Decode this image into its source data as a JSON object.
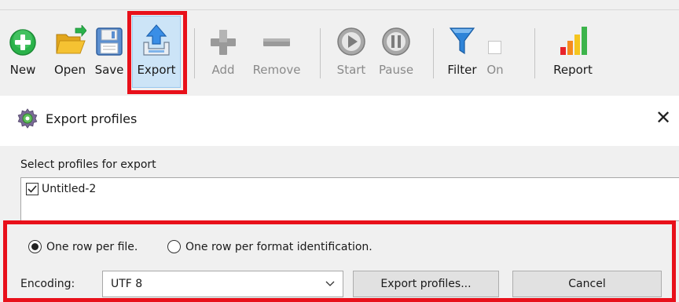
{
  "toolbar": {
    "buttons": {
      "new": "New",
      "open": "Open",
      "save": "Save",
      "export": "Export",
      "add": "Add",
      "remove": "Remove",
      "start": "Start",
      "pause": "Pause",
      "filter": "Filter",
      "on": "On",
      "report": "Report"
    },
    "icons": {
      "new": "plus-circle-icon",
      "open": "folder-open-icon",
      "save": "floppy-disk-icon",
      "export": "export-tray-icon",
      "add": "plus-icon",
      "remove": "minus-icon",
      "start": "play-icon",
      "pause": "pause-icon",
      "filter": "funnel-icon",
      "report": "bar-chart-icon"
    },
    "export_active": true,
    "filter_on": false
  },
  "dialog": {
    "title": "Export profiles",
    "close_symbol": "✕",
    "select_label": "Select profiles for export",
    "profiles": [
      {
        "name": "Untitled-2",
        "checked": true
      }
    ],
    "radio_options": [
      {
        "label": "One row per file.",
        "selected": true
      },
      {
        "label": "One row per format identification.",
        "selected": false
      }
    ],
    "encoding_label": "Encoding:",
    "encoding_value": "UTF 8",
    "export_button": "Export profiles...",
    "cancel_button": "Cancel"
  },
  "colors": {
    "highlight_border": "#e8101a",
    "active_button_bg": "#cce4f7",
    "new_green": "#2ab24a",
    "folder_yellow": "#f5c232",
    "save_blue": "#5b8fd0",
    "export_blue": "#3a8ee6",
    "disabled_gray": "#9a9a9a",
    "filter_blue": "#2e84d8"
  }
}
